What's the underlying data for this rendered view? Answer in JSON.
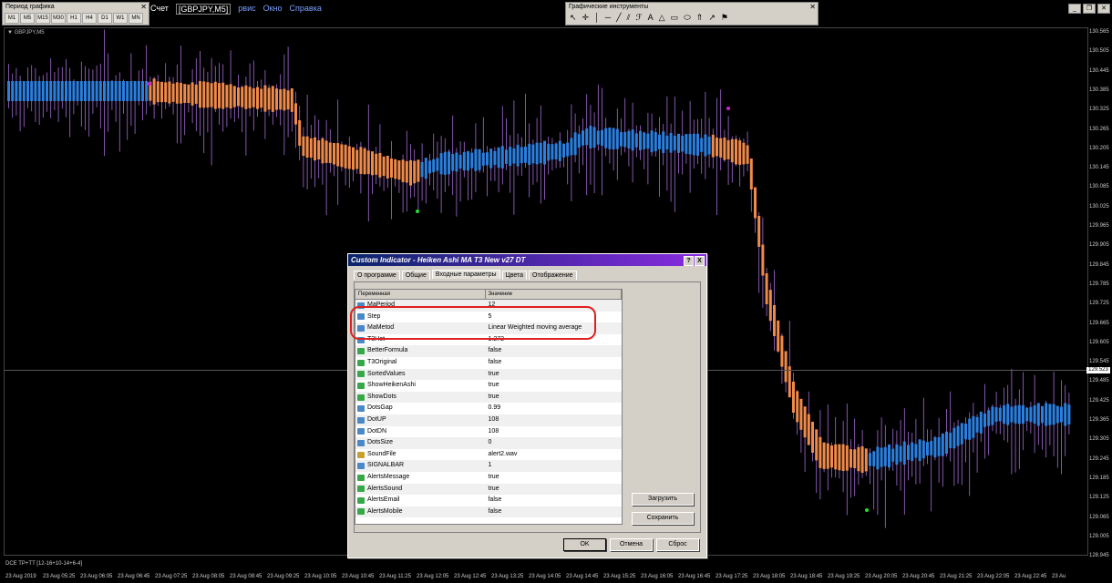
{
  "period_toolbar": {
    "title": "Период графика",
    "buttons": [
      "M1",
      "M5",
      "M15",
      "M30",
      "H1",
      "H4",
      "D1",
      "W1",
      "MN"
    ]
  },
  "menubar": {
    "items": [
      "рвис",
      "Окно",
      "Справка"
    ],
    "prefix": "Счет",
    "chart_tab": "[GBPJPY,M5]"
  },
  "graph_toolbar": {
    "title": "Графические инструменты"
  },
  "chart": {
    "symbol": "GBPJPY,M5",
    "subwindow_label": "DCE TP+TT [12-16+10-14+6-4]",
    "current_price": "129.523",
    "price_labels": [
      "130.565",
      "130.505",
      "130.445",
      "130.385",
      "130.325",
      "130.265",
      "130.205",
      "130.145",
      "130.085",
      "130.025",
      "129.965",
      "129.905",
      "129.845",
      "129.785",
      "129.725",
      "129.665",
      "129.605",
      "129.545",
      "129.485",
      "129.425",
      "129.365",
      "129.305",
      "129.245",
      "129.185",
      "129.125",
      "129.065",
      "129.005",
      "128.945"
    ],
    "time_labels": [
      "23 Aug 2019",
      "23 Aug 05:25",
      "23 Aug 06:05",
      "23 Aug 06:45",
      "23 Aug 07:25",
      "23 Aug 08:05",
      "23 Aug 08:45",
      "23 Aug 09:25",
      "23 Aug 10:05",
      "23 Aug 10:45",
      "23 Aug 11:25",
      "23 Aug 12:05",
      "23 Aug 12:45",
      "23 Aug 13:25",
      "23 Aug 14:05",
      "23 Aug 14:45",
      "23 Aug 15:25",
      "23 Aug 16:05",
      "23 Aug 16:45",
      "23 Aug 17:25",
      "23 Aug 18:05",
      "23 Aug 18:45",
      "23 Aug 19:25",
      "23 Aug 20:05",
      "23 Aug 20:45",
      "23 Aug 21:25",
      "23 Aug 22:05",
      "23 Aug 22:45",
      "23 Au"
    ],
    "colors": {
      "bull": "#2b7fe0",
      "bear": "#f08a4b",
      "wick": "#a36bd6"
    }
  },
  "dialog": {
    "title": "Custom Indicator - Heiken Ashi MA T3 New v27 DT",
    "help": "?",
    "close": "X",
    "tabs": [
      "О программе",
      "Общие",
      "Входные параметры",
      "Цвета",
      "Отображение"
    ],
    "columns": [
      "Переменная",
      "Значение"
    ],
    "rows": [
      {
        "type": "num",
        "name": "MaPeriod",
        "value": "12"
      },
      {
        "type": "num",
        "name": "Step",
        "value": "5"
      },
      {
        "type": "num",
        "name": "MaMetod",
        "value": "Linear Weighted moving average"
      },
      {
        "type": "num",
        "name": "T3Hot",
        "value": "1.272"
      },
      {
        "type": "bool",
        "name": "BetterFormula",
        "value": "false"
      },
      {
        "type": "bool",
        "name": "T3Original",
        "value": "false"
      },
      {
        "type": "bool",
        "name": "SortedValues",
        "value": "true"
      },
      {
        "type": "bool",
        "name": "ShowHeikenAshi",
        "value": "true"
      },
      {
        "type": "bool",
        "name": "ShowDots",
        "value": "true"
      },
      {
        "type": "num",
        "name": "DotsGap",
        "value": "0.99"
      },
      {
        "type": "num",
        "name": "DotUP",
        "value": "108"
      },
      {
        "type": "num",
        "name": "DotDN",
        "value": "108"
      },
      {
        "type": "num",
        "name": "DotsSize",
        "value": "0"
      },
      {
        "type": "str",
        "name": "SoundFile",
        "value": "alert2.wav"
      },
      {
        "type": "num",
        "name": "SIGNALBAR",
        "value": "1"
      },
      {
        "type": "bool",
        "name": "AlertsMessage",
        "value": "true"
      },
      {
        "type": "bool",
        "name": "AlertsSound",
        "value": "true"
      },
      {
        "type": "bool",
        "name": "AlertsEmail",
        "value": "false"
      },
      {
        "type": "bool",
        "name": "AlertsMobile",
        "value": "false"
      }
    ],
    "load_label": "Загрузить",
    "save_label": "Сохранить",
    "ok_label": "OK",
    "cancel_label": "Отмена",
    "reset_label": "Сброс"
  }
}
